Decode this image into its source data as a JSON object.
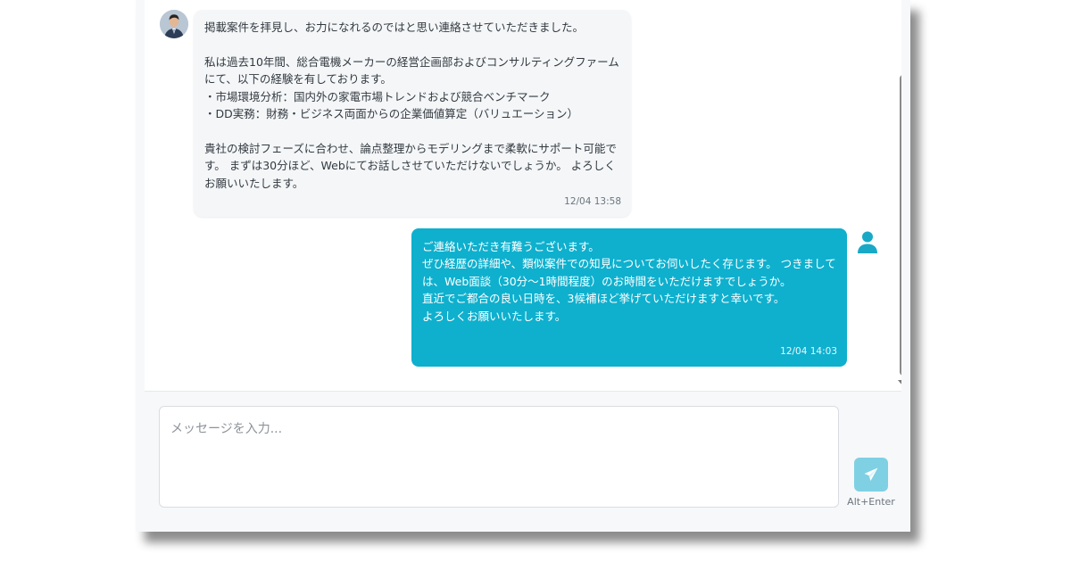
{
  "messages": [
    {
      "direction": "incoming",
      "text": "掲載案件を拝見し、お力になれるのではと思い連絡させていただきました。\n\n私は過去10年間、総合電機メーカーの経営企画部およびコンサルティングファームにて、以下の経験を有しております。\n・市場環境分析：国内外の家電市場トレンドおよび競合ベンチマーク\n・DD実務：財務・ビジネス両面からの企業価値算定（バリュエーション）\n\n貴社の検討フェーズに合わせ、論点整理からモデリングまで柔軟にサポート可能です。 まずは30分ほど、Webにてお話しさせていただけないでしょうか。 よろしくお願いいたします。",
      "time": "12/04 13:58"
    },
    {
      "direction": "outgoing",
      "text": "ご連絡いただき有難うございます。\nぜひ経歴の詳細や、類似案件での知見についてお伺いしたく存じます。 つきましては、Web面談（30分〜1時間程度）のお時間をいただけますでしょうか。\n直近でご都合の良い日時を、3候補ほど挙げていただけますと幸いです。\nよろしくお願いいたします。",
      "time": "12/04 14:03"
    }
  ],
  "composer": {
    "placeholder": "メッセージを入力...",
    "value": "",
    "shortcut_hint": "Alt+Enter"
  },
  "icons": {
    "sender_avatar": "avatar-photo",
    "user_avatar": "user-icon",
    "send": "paper-plane-icon"
  },
  "colors": {
    "outgoing_bubble": "#0eb0ce",
    "incoming_bubble": "#f4f6f8",
    "send_button": "#7fd0e3"
  }
}
